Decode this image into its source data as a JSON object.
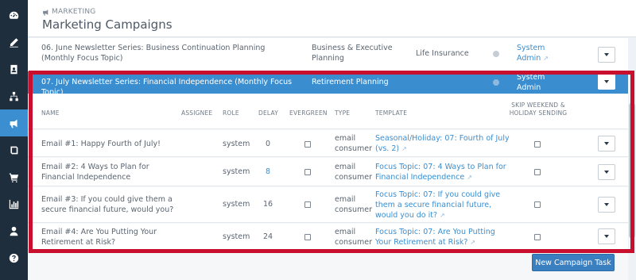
{
  "header": {
    "breadcrumb": "MARKETING",
    "title": "Marketing Campaigns"
  },
  "sidebar": {
    "items": [
      {
        "icon": "dashboard-icon"
      },
      {
        "icon": "pencil-icon"
      },
      {
        "icon": "contact-card-icon"
      },
      {
        "icon": "sitemap-icon"
      },
      {
        "icon": "megaphone-icon",
        "active": true
      },
      {
        "icon": "book-icon"
      },
      {
        "icon": "cart-icon"
      },
      {
        "icon": "bar-chart-icon"
      },
      {
        "icon": "user-icon"
      },
      {
        "icon": "help-icon"
      }
    ]
  },
  "campaigns": [
    {
      "name": "06. June Newsletter Series: Business Continuation Planning (Monthly Focus Topic)",
      "category": "Business & Executive Planning",
      "product": "Life Insurance",
      "owner": "System Admin"
    },
    {
      "name": "07. July Newsletter Series: Financial Independence (Monthly Focus Topic)",
      "category": "Retirement Planning",
      "product": "",
      "owner": "System Admin"
    }
  ],
  "table": {
    "headers": {
      "name": "NAME",
      "assignee": "ASSIGNEE",
      "role": "ROLE",
      "delay": "DELAY",
      "evergreen": "EVERGREEN",
      "type": "TYPE",
      "template": "TEMPLATE",
      "skip": "SKIP WEEKEND & HOLIDAY SENDING"
    },
    "rows": [
      {
        "name": "Email #1: Happy Fourth of July!",
        "role": "system",
        "delay": "0",
        "type": "email consumer",
        "template": "Seasonal/Holiday: 07: Fourth of July (vs. 2)"
      },
      {
        "name": "Email #2: 4 Ways to Plan for Financial Independence",
        "role": "system",
        "delay": "8",
        "type": "email consumer",
        "template": "Focus Topic: 07: 4 Ways to Plan for Financial Independence"
      },
      {
        "name": "Email #3: If you could give them a secure financial future, would you?",
        "role": "system",
        "delay": "16",
        "type": "email consumer",
        "template": "Focus Topic: 07: If you could give them a secure financial future, would you do it?"
      },
      {
        "name": "Email #4: Are You Putting Your Retirement at Risk?",
        "role": "system",
        "delay": "24",
        "type": "email consumer",
        "template": "Focus Topic: 07: Are You Putting Your Retirement at Risk?"
      }
    ]
  },
  "actions": {
    "new_task": "New Campaign Task"
  },
  "colors": {
    "sidebar": "#1f2e3d",
    "accent": "#3a8ed0",
    "highlight": "#c8102e"
  }
}
